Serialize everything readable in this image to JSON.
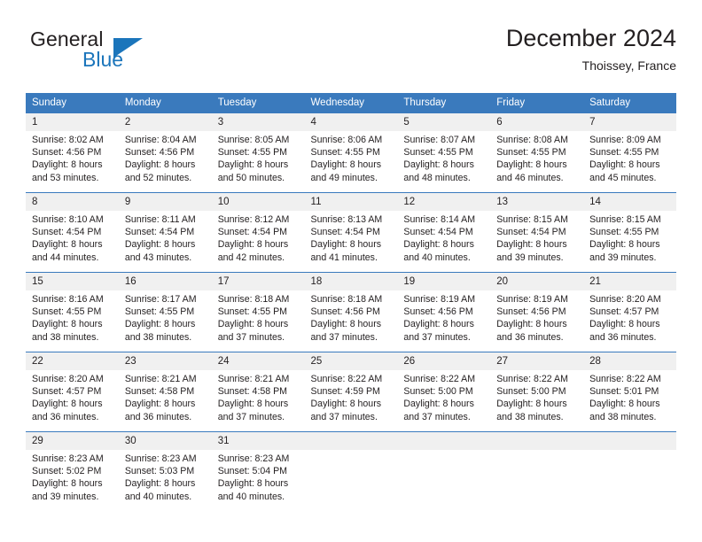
{
  "brand": {
    "name_top": "General",
    "name_bottom": "Blue",
    "accent_color": "#1b75bb"
  },
  "header": {
    "title": "December 2024",
    "subtitle": "Thoissey, France"
  },
  "colors": {
    "header_row_bg": "#3a7abd",
    "header_row_text": "#ffffff",
    "daynum_bg": "#f0f0f0",
    "text": "#231f20",
    "grid_line": "#3a7abd"
  },
  "weekday_headers": [
    "Sunday",
    "Monday",
    "Tuesday",
    "Wednesday",
    "Thursday",
    "Friday",
    "Saturday"
  ],
  "labels": {
    "sunrise_prefix": "Sunrise:",
    "sunset_prefix": "Sunset:",
    "daylight_prefix": "Daylight:"
  },
  "weeks": [
    [
      {
        "day": "1",
        "sunrise": "Sunrise: 8:02 AM",
        "sunset": "Sunset: 4:56 PM",
        "daylight1": "Daylight: 8 hours",
        "daylight2": "and 53 minutes."
      },
      {
        "day": "2",
        "sunrise": "Sunrise: 8:04 AM",
        "sunset": "Sunset: 4:56 PM",
        "daylight1": "Daylight: 8 hours",
        "daylight2": "and 52 minutes."
      },
      {
        "day": "3",
        "sunrise": "Sunrise: 8:05 AM",
        "sunset": "Sunset: 4:55 PM",
        "daylight1": "Daylight: 8 hours",
        "daylight2": "and 50 minutes."
      },
      {
        "day": "4",
        "sunrise": "Sunrise: 8:06 AM",
        "sunset": "Sunset: 4:55 PM",
        "daylight1": "Daylight: 8 hours",
        "daylight2": "and 49 minutes."
      },
      {
        "day": "5",
        "sunrise": "Sunrise: 8:07 AM",
        "sunset": "Sunset: 4:55 PM",
        "daylight1": "Daylight: 8 hours",
        "daylight2": "and 48 minutes."
      },
      {
        "day": "6",
        "sunrise": "Sunrise: 8:08 AM",
        "sunset": "Sunset: 4:55 PM",
        "daylight1": "Daylight: 8 hours",
        "daylight2": "and 46 minutes."
      },
      {
        "day": "7",
        "sunrise": "Sunrise: 8:09 AM",
        "sunset": "Sunset: 4:55 PM",
        "daylight1": "Daylight: 8 hours",
        "daylight2": "and 45 minutes."
      }
    ],
    [
      {
        "day": "8",
        "sunrise": "Sunrise: 8:10 AM",
        "sunset": "Sunset: 4:54 PM",
        "daylight1": "Daylight: 8 hours",
        "daylight2": "and 44 minutes."
      },
      {
        "day": "9",
        "sunrise": "Sunrise: 8:11 AM",
        "sunset": "Sunset: 4:54 PM",
        "daylight1": "Daylight: 8 hours",
        "daylight2": "and 43 minutes."
      },
      {
        "day": "10",
        "sunrise": "Sunrise: 8:12 AM",
        "sunset": "Sunset: 4:54 PM",
        "daylight1": "Daylight: 8 hours",
        "daylight2": "and 42 minutes."
      },
      {
        "day": "11",
        "sunrise": "Sunrise: 8:13 AM",
        "sunset": "Sunset: 4:54 PM",
        "daylight1": "Daylight: 8 hours",
        "daylight2": "and 41 minutes."
      },
      {
        "day": "12",
        "sunrise": "Sunrise: 8:14 AM",
        "sunset": "Sunset: 4:54 PM",
        "daylight1": "Daylight: 8 hours",
        "daylight2": "and 40 minutes."
      },
      {
        "day": "13",
        "sunrise": "Sunrise: 8:15 AM",
        "sunset": "Sunset: 4:54 PM",
        "daylight1": "Daylight: 8 hours",
        "daylight2": "and 39 minutes."
      },
      {
        "day": "14",
        "sunrise": "Sunrise: 8:15 AM",
        "sunset": "Sunset: 4:55 PM",
        "daylight1": "Daylight: 8 hours",
        "daylight2": "and 39 minutes."
      }
    ],
    [
      {
        "day": "15",
        "sunrise": "Sunrise: 8:16 AM",
        "sunset": "Sunset: 4:55 PM",
        "daylight1": "Daylight: 8 hours",
        "daylight2": "and 38 minutes."
      },
      {
        "day": "16",
        "sunrise": "Sunrise: 8:17 AM",
        "sunset": "Sunset: 4:55 PM",
        "daylight1": "Daylight: 8 hours",
        "daylight2": "and 38 minutes."
      },
      {
        "day": "17",
        "sunrise": "Sunrise: 8:18 AM",
        "sunset": "Sunset: 4:55 PM",
        "daylight1": "Daylight: 8 hours",
        "daylight2": "and 37 minutes."
      },
      {
        "day": "18",
        "sunrise": "Sunrise: 8:18 AM",
        "sunset": "Sunset: 4:56 PM",
        "daylight1": "Daylight: 8 hours",
        "daylight2": "and 37 minutes."
      },
      {
        "day": "19",
        "sunrise": "Sunrise: 8:19 AM",
        "sunset": "Sunset: 4:56 PM",
        "daylight1": "Daylight: 8 hours",
        "daylight2": "and 37 minutes."
      },
      {
        "day": "20",
        "sunrise": "Sunrise: 8:19 AM",
        "sunset": "Sunset: 4:56 PM",
        "daylight1": "Daylight: 8 hours",
        "daylight2": "and 36 minutes."
      },
      {
        "day": "21",
        "sunrise": "Sunrise: 8:20 AM",
        "sunset": "Sunset: 4:57 PM",
        "daylight1": "Daylight: 8 hours",
        "daylight2": "and 36 minutes."
      }
    ],
    [
      {
        "day": "22",
        "sunrise": "Sunrise: 8:20 AM",
        "sunset": "Sunset: 4:57 PM",
        "daylight1": "Daylight: 8 hours",
        "daylight2": "and 36 minutes."
      },
      {
        "day": "23",
        "sunrise": "Sunrise: 8:21 AM",
        "sunset": "Sunset: 4:58 PM",
        "daylight1": "Daylight: 8 hours",
        "daylight2": "and 36 minutes."
      },
      {
        "day": "24",
        "sunrise": "Sunrise: 8:21 AM",
        "sunset": "Sunset: 4:58 PM",
        "daylight1": "Daylight: 8 hours",
        "daylight2": "and 37 minutes."
      },
      {
        "day": "25",
        "sunrise": "Sunrise: 8:22 AM",
        "sunset": "Sunset: 4:59 PM",
        "daylight1": "Daylight: 8 hours",
        "daylight2": "and 37 minutes."
      },
      {
        "day": "26",
        "sunrise": "Sunrise: 8:22 AM",
        "sunset": "Sunset: 5:00 PM",
        "daylight1": "Daylight: 8 hours",
        "daylight2": "and 37 minutes."
      },
      {
        "day": "27",
        "sunrise": "Sunrise: 8:22 AM",
        "sunset": "Sunset: 5:00 PM",
        "daylight1": "Daylight: 8 hours",
        "daylight2": "and 38 minutes."
      },
      {
        "day": "28",
        "sunrise": "Sunrise: 8:22 AM",
        "sunset": "Sunset: 5:01 PM",
        "daylight1": "Daylight: 8 hours",
        "daylight2": "and 38 minutes."
      }
    ],
    [
      {
        "day": "29",
        "sunrise": "Sunrise: 8:23 AM",
        "sunset": "Sunset: 5:02 PM",
        "daylight1": "Daylight: 8 hours",
        "daylight2": "and 39 minutes."
      },
      {
        "day": "30",
        "sunrise": "Sunrise: 8:23 AM",
        "sunset": "Sunset: 5:03 PM",
        "daylight1": "Daylight: 8 hours",
        "daylight2": "and 40 minutes."
      },
      {
        "day": "31",
        "sunrise": "Sunrise: 8:23 AM",
        "sunset": "Sunset: 5:04 PM",
        "daylight1": "Daylight: 8 hours",
        "daylight2": "and 40 minutes."
      },
      {
        "day": "",
        "sunrise": "",
        "sunset": "",
        "daylight1": "",
        "daylight2": ""
      },
      {
        "day": "",
        "sunrise": "",
        "sunset": "",
        "daylight1": "",
        "daylight2": ""
      },
      {
        "day": "",
        "sunrise": "",
        "sunset": "",
        "daylight1": "",
        "daylight2": ""
      },
      {
        "day": "",
        "sunrise": "",
        "sunset": "",
        "daylight1": "",
        "daylight2": ""
      }
    ]
  ]
}
